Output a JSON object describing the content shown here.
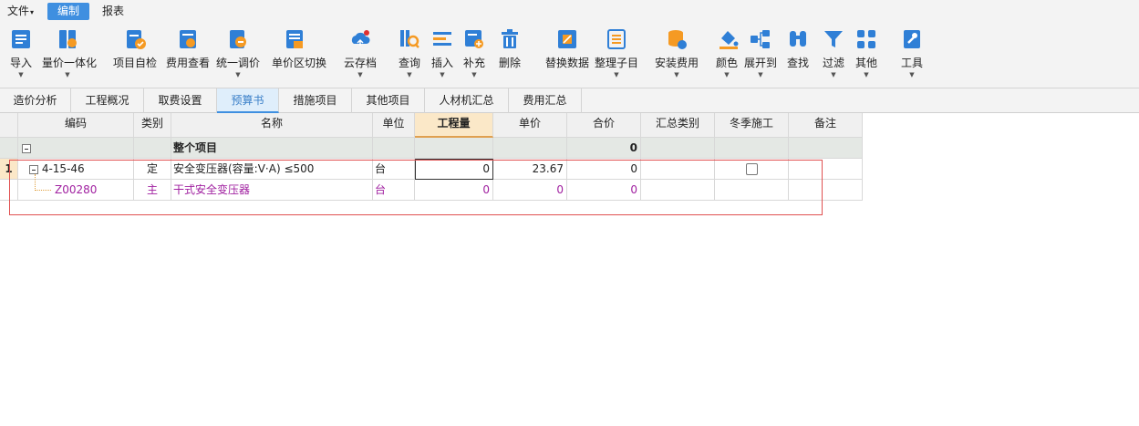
{
  "menu": {
    "file": "文件",
    "edit": "编制",
    "report": "报表"
  },
  "toolbar": {
    "items": [
      {
        "label": "导入",
        "icon": "import-icon"
      },
      {
        "label": "量价一体化",
        "icon": "quantity-price-icon"
      },
      {
        "label": "项目自检",
        "icon": "self-check-icon"
      },
      {
        "label": "费用查看",
        "icon": "fee-view-icon"
      },
      {
        "label": "统一调价",
        "icon": "unified-price-icon"
      },
      {
        "label": "单价区切换",
        "icon": "price-zone-icon"
      },
      {
        "label": "云存档",
        "icon": "cloud-archive-icon"
      },
      {
        "label": "查询",
        "icon": "query-icon"
      },
      {
        "label": "插入",
        "icon": "insert-icon"
      },
      {
        "label": "补充",
        "icon": "supplement-icon"
      },
      {
        "label": "删除",
        "icon": "delete-icon"
      },
      {
        "label": "替换数据",
        "icon": "replace-data-icon"
      },
      {
        "label": "整理子目",
        "icon": "organize-icon"
      },
      {
        "label": "安装费用",
        "icon": "install-fee-icon"
      },
      {
        "label": "颜色",
        "icon": "color-icon"
      },
      {
        "label": "展开到",
        "icon": "expand-icon"
      },
      {
        "label": "查找",
        "icon": "find-icon"
      },
      {
        "label": "过滤",
        "icon": "filter-icon"
      },
      {
        "label": "其他",
        "icon": "other-icon"
      },
      {
        "label": "工具",
        "icon": "tools-icon"
      }
    ]
  },
  "tabs": [
    "造价分析",
    "工程概况",
    "取费设置",
    "预算书",
    "措施项目",
    "其他项目",
    "人材机汇总",
    "费用汇总"
  ],
  "active_tab": "预算书",
  "grid": {
    "headers": [
      "编码",
      "类别",
      "名称",
      "单位",
      "工程量",
      "单价",
      "合价",
      "汇总类别",
      "冬季施工",
      "备注"
    ],
    "group_row": {
      "name": "整个项目",
      "total": "0"
    },
    "rows": [
      {
        "num": "1",
        "code": "4-15-46",
        "type": "定",
        "name": "安全变压器(容量:V·A) ≤500",
        "unit": "台",
        "qty": "0",
        "price": "23.67",
        "total": "0"
      },
      {
        "num": "",
        "code": "Z00280",
        "type": "主",
        "name": "干式安全变压器",
        "unit": "台",
        "qty": "0",
        "price": "0",
        "total": "0"
      }
    ]
  },
  "colors": {
    "accent": "#3f8fe0",
    "purple": "#a020a0",
    "highlight": "#e05050"
  }
}
